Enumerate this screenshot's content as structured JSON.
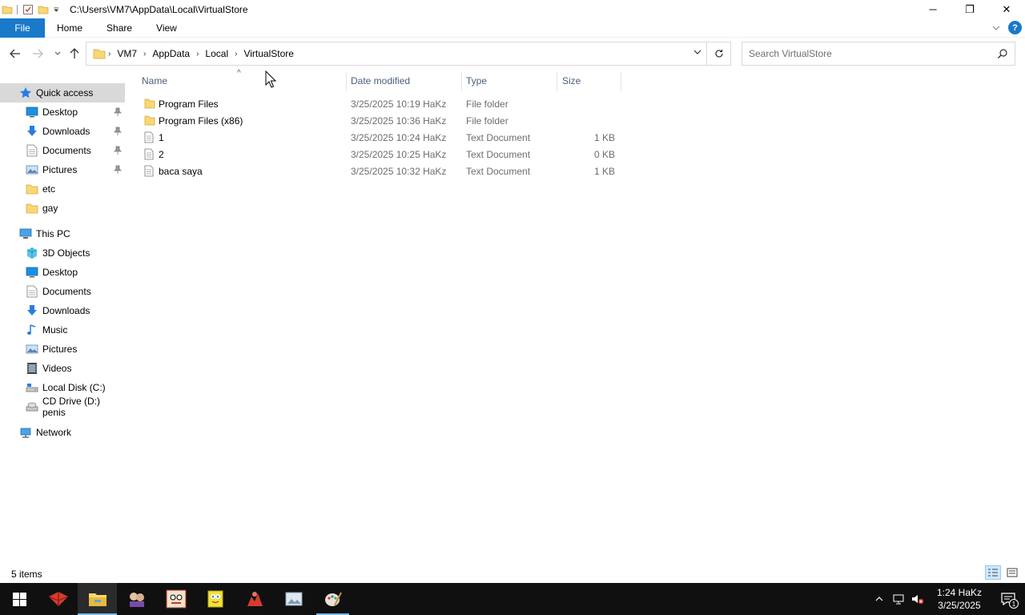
{
  "window": {
    "title_path": "C:\\Users\\VM7\\AppData\\Local\\VirtualStore",
    "controls": {
      "minimize": "─",
      "maximize": "❐",
      "close": "✕"
    }
  },
  "ribbon": {
    "tabs": [
      "File",
      "Home",
      "Share",
      "View"
    ],
    "help": "?"
  },
  "address": {
    "breadcrumbs": [
      "VM7",
      "AppData",
      "Local",
      "VirtualStore"
    ],
    "search_placeholder": "Search VirtualStore"
  },
  "nav": {
    "quick_access": {
      "label": "Quick access",
      "items": [
        {
          "label": "Desktop",
          "icon": "desktop-icon",
          "pinned": true
        },
        {
          "label": "Downloads",
          "icon": "downloads-icon",
          "pinned": true
        },
        {
          "label": "Documents",
          "icon": "documents-icon",
          "pinned": true
        },
        {
          "label": "Pictures",
          "icon": "pictures-icon",
          "pinned": true
        },
        {
          "label": "etc",
          "icon": "folder-icon",
          "pinned": false
        },
        {
          "label": "gay",
          "icon": "folder-icon",
          "pinned": false
        }
      ]
    },
    "this_pc": {
      "label": "This PC",
      "items": [
        {
          "label": "3D Objects",
          "icon": "3d-objects-icon"
        },
        {
          "label": "Desktop",
          "icon": "desktop-icon"
        },
        {
          "label": "Documents",
          "icon": "documents-icon"
        },
        {
          "label": "Downloads",
          "icon": "downloads-icon"
        },
        {
          "label": "Music",
          "icon": "music-icon"
        },
        {
          "label": "Pictures",
          "icon": "pictures-icon"
        },
        {
          "label": "Videos",
          "icon": "videos-icon"
        },
        {
          "label": "Local Disk (C:)",
          "icon": "local-disk-icon"
        },
        {
          "label": "CD Drive (D:) penis",
          "icon": "cd-drive-icon"
        }
      ]
    },
    "network": {
      "label": "Network"
    }
  },
  "columns": {
    "name": "Name",
    "date": "Date modified",
    "type": "Type",
    "size": "Size"
  },
  "files": [
    {
      "name": "Program Files",
      "date": "3/25/2025 10:19 HaKz",
      "type": "File folder",
      "size": "",
      "kind": "folder"
    },
    {
      "name": "Program Files (x86)",
      "date": "3/25/2025 10:36 HaKz",
      "type": "File folder",
      "size": "",
      "kind": "folder"
    },
    {
      "name": "1",
      "date": "3/25/2025 10:24 HaKz",
      "type": "Text Document",
      "size": "1 KB",
      "kind": "text"
    },
    {
      "name": "2",
      "date": "3/25/2025 10:25 HaKz",
      "type": "Text Document",
      "size": "0 KB",
      "kind": "text"
    },
    {
      "name": "baca saya",
      "date": "3/25/2025 10:32 HaKz",
      "type": "Text Document",
      "size": "1 KB",
      "kind": "text"
    }
  ],
  "status": {
    "item_count": "5 items"
  },
  "taskbar": {
    "clock_time": "1:24 HaKz",
    "clock_date": "3/25/2025",
    "notification_count": "1"
  },
  "colors": {
    "accent": "#1979ca",
    "folder": "#f8d775",
    "taskbar": "#101010",
    "selection": "#cce8ff"
  }
}
